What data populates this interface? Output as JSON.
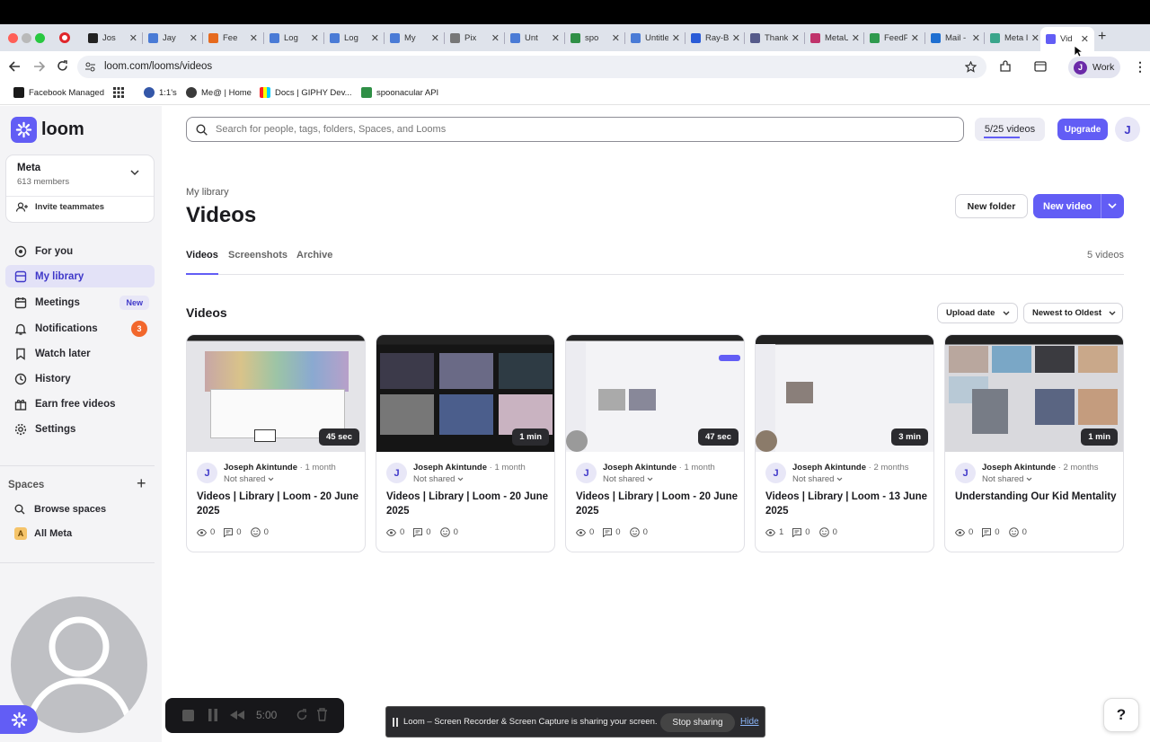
{
  "browser": {
    "tabs": [
      {
        "label": "Jos",
        "icon": "github-icon",
        "color": "#222222"
      },
      {
        "label": "Jay",
        "icon": "docs-icon",
        "color": "#4a7bd6"
      },
      {
        "label": "Fee",
        "icon": "fire-icon",
        "color": "#e66a1e"
      },
      {
        "label": "Log",
        "icon": "list-icon",
        "color": "#4a7bd6"
      },
      {
        "label": "Log",
        "icon": "list-icon",
        "color": "#4a7bd6"
      },
      {
        "label": "My",
        "icon": "docs-icon",
        "color": "#4a7bd6"
      },
      {
        "label": "Pix",
        "icon": "pixel-icon",
        "color": "#777777"
      },
      {
        "label": "Unt",
        "icon": "docs-icon",
        "color": "#4a7bd6"
      },
      {
        "label": "spo",
        "icon": "spoon-icon",
        "color": "#2f8f46"
      },
      {
        "label": "Untitled",
        "icon": "docs-icon",
        "color": "#4a7bd6"
      },
      {
        "label": "Ray-Ba",
        "icon": "meta-icon",
        "color": "#2a5bd7"
      },
      {
        "label": "Thanks",
        "icon": "avatar-icon",
        "color": "#555a8a"
      },
      {
        "label": "MetaU",
        "icon": "metau-icon",
        "color": "#c0336b"
      },
      {
        "label": "FeedPi",
        "icon": "sheet-icon",
        "color": "#2f9a4e"
      },
      {
        "label": "Mail - J",
        "icon": "outlook-icon",
        "color": "#1f6fd1"
      },
      {
        "label": "Meta In",
        "icon": "link-icon",
        "color": "#3aa58b"
      },
      {
        "label": "Vid",
        "icon": "loom-icon",
        "color": "#625df5"
      }
    ],
    "url": "loom.com/looms/videos",
    "profile": {
      "initial": "J",
      "label": "Work"
    },
    "bookmarks": [
      "Facebook Managed",
      "1:1's",
      "Me@ | Home",
      "Docs | GIPHY Dev...",
      "spoonacular API"
    ]
  },
  "header": {
    "search_placeholder": "Search for people, tags, folders, Spaces, and Looms",
    "video_count_pill": "5/25 videos",
    "upgrade": "Upgrade",
    "avatar_initial": "J"
  },
  "sidebar": {
    "logo": "loom",
    "workspace": {
      "name": "Meta",
      "members": "613 members"
    },
    "invite": "Invite teammates",
    "nav": [
      {
        "label": "For you",
        "icon": "target-icon"
      },
      {
        "label": "My library",
        "icon": "library-icon",
        "active": true
      },
      {
        "label": "Meetings",
        "icon": "calendar-icon",
        "badge": "New"
      },
      {
        "label": "Notifications",
        "icon": "bell-icon",
        "count": "3"
      },
      {
        "label": "Watch later",
        "icon": "bookmark-icon"
      },
      {
        "label": "History",
        "icon": "clock-icon"
      },
      {
        "label": "Earn free videos",
        "icon": "gift-icon"
      },
      {
        "label": "Settings",
        "icon": "gear-icon"
      }
    ],
    "spaces_label": "Spaces",
    "browse_spaces": "Browse spaces",
    "all_meta": {
      "initial": "A",
      "label": "All Meta"
    }
  },
  "main": {
    "breadcrumb": "My library",
    "title": "Videos",
    "new_folder": "New folder",
    "new_video": "New video",
    "tabs": [
      "Videos",
      "Screenshots",
      "Archive"
    ],
    "active_tab": "Videos",
    "count": "5 videos",
    "section": "Videos",
    "sort_field": "Upload date",
    "sort_order": "Newest to Oldest",
    "videos": [
      {
        "duration": "45 sec",
        "author": "Joseph Akintunde",
        "ago": "1 month",
        "sharing": "Not shared",
        "title": "Videos | Library | Loom - 20 June 2025",
        "views": "0",
        "comments": "0",
        "reactions": "0"
      },
      {
        "duration": "1 min",
        "author": "Joseph Akintunde",
        "ago": "1 month",
        "sharing": "Not shared",
        "title": "Videos | Library | Loom - 20 June 2025",
        "views": "0",
        "comments": "0",
        "reactions": "0"
      },
      {
        "duration": "47 sec",
        "author": "Joseph Akintunde",
        "ago": "1 month",
        "sharing": "Not shared",
        "title": "Videos | Library | Loom - 20 June 2025",
        "views": "0",
        "comments": "0",
        "reactions": "0"
      },
      {
        "duration": "3 min",
        "author": "Joseph Akintunde",
        "ago": "2 months",
        "sharing": "Not shared",
        "title": "Videos | Library | Loom - 13 June 2025",
        "views": "1",
        "comments": "0",
        "reactions": "0"
      },
      {
        "duration": "1 min",
        "author": "Joseph Akintunde",
        "ago": "2 months",
        "sharing": "Not shared",
        "title": "Understanding Our Kid Mentality",
        "views": "0",
        "comments": "0",
        "reactions": "0"
      }
    ]
  },
  "recorder": {
    "timer": "5:00"
  },
  "share_bar": {
    "message": "Loom – Screen Recorder & Screen Capture is sharing your screen.",
    "stop": "Stop sharing",
    "hide": "Hide"
  },
  "help": "?",
  "colors": {
    "accent": "#625df5",
    "sidebar_bg": "#f4f4f6",
    "active_bg": "#e3e2f7",
    "badge": "#f2672c"
  }
}
